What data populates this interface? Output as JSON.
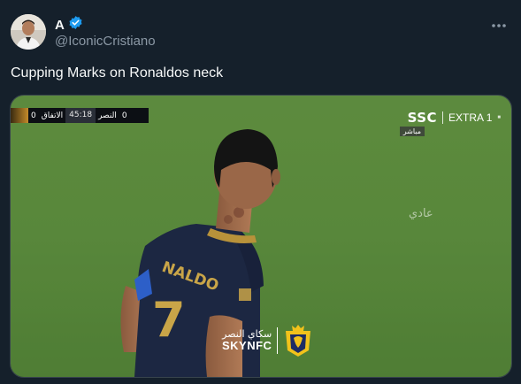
{
  "author": {
    "display_name": "A",
    "handle": "@IconicCristiano",
    "verified": true
  },
  "tweet": {
    "text": "Cupping Marks on Ronaldos neck"
  },
  "icons": {
    "verified": "verified-badge-icon",
    "more": "more-options-icon"
  },
  "media": {
    "scorebug": {
      "team1_score": "0",
      "team1_name": "الاتفاق",
      "clock": "45:18",
      "team2_name": "النصر",
      "team2_score": "0"
    },
    "broadcaster": {
      "logo": "SSC",
      "channel": "EXTRA 1",
      "live_label": "مباشر"
    },
    "watermark": "عادي",
    "jersey": {
      "name": "NALDO",
      "number": "7"
    },
    "club_logo": {
      "arabic": "سكاي النصر",
      "english": "SKYNFC",
      "badge_text": "SKYNFC"
    }
  },
  "colors": {
    "background": "#15202b",
    "text_primary": "#f7f9f9",
    "text_secondary": "#8b98a5",
    "verified_blue": "#1d9bf0",
    "pitch_green": "#5d8b3f",
    "jersey_navy": "#1c2742"
  }
}
